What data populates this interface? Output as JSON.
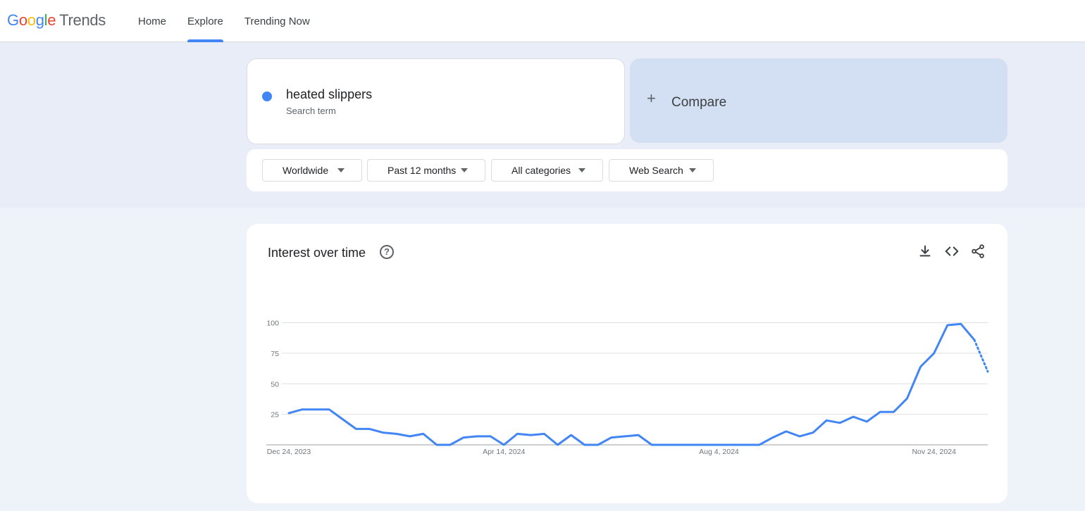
{
  "header": {
    "logo_google": [
      "G",
      "o",
      "o",
      "g",
      "l",
      "e"
    ],
    "logo_trends": "Trends",
    "nav": [
      {
        "label": "Home",
        "active": false
      },
      {
        "label": "Explore",
        "active": true
      },
      {
        "label": "Trending Now",
        "active": false
      }
    ]
  },
  "search": {
    "term": "heated slippers",
    "term_type": "Search term",
    "term_color": "#4285f4",
    "compare_label": "Compare"
  },
  "filters": [
    {
      "label": "Worldwide"
    },
    {
      "label": "Past 12 months"
    },
    {
      "label": "All categories"
    },
    {
      "label": "Web Search"
    }
  ],
  "card": {
    "title": "Interest over time",
    "help_glyph": "?",
    "actions": [
      "download-icon",
      "embed-code-icon",
      "share-icon"
    ]
  },
  "chart_data": {
    "type": "line",
    "ylim": [
      0,
      100
    ],
    "y_ticks": [
      25,
      50,
      75,
      100
    ],
    "x_tick_labels": [
      {
        "label": "Dec 24, 2023",
        "index": 0
      },
      {
        "label": "Apr 14, 2024",
        "index": 16
      },
      {
        "label": "Aug 4, 2024",
        "index": 32
      },
      {
        "label": "Nov 24, 2024",
        "index": 48
      }
    ],
    "partial_from_index": 51,
    "series": [
      {
        "color": "#4285f4",
        "values": [
          26,
          29,
          29,
          29,
          21,
          13,
          13,
          10,
          9,
          7,
          9,
          0,
          0,
          6,
          7,
          7,
          0,
          9,
          8,
          9,
          0,
          8,
          0,
          0,
          6,
          7,
          8,
          0,
          0,
          0,
          0,
          0,
          0,
          0,
          0,
          0,
          6,
          11,
          7,
          10,
          20,
          18,
          23,
          19,
          27,
          27,
          38,
          64,
          75,
          98,
          99,
          86,
          60
        ]
      }
    ]
  }
}
